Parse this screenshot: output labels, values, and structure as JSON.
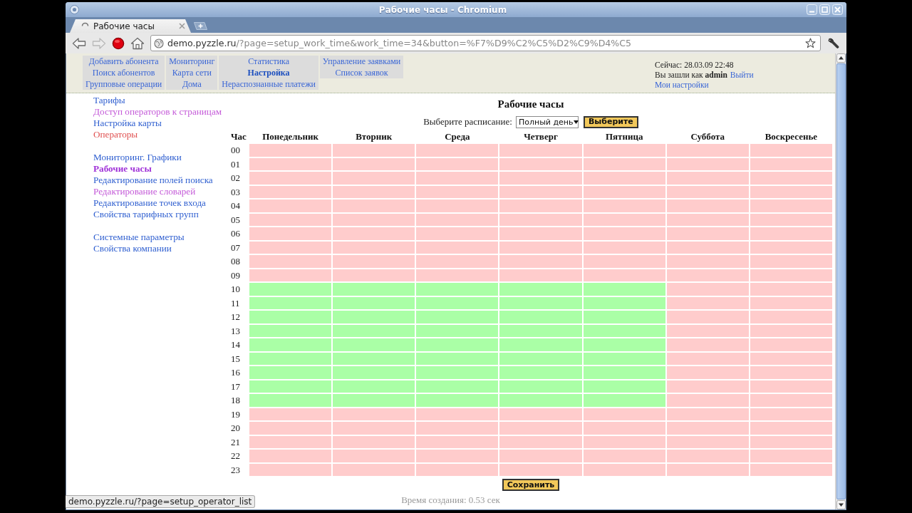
{
  "window": {
    "title": "Рабочие часы - Chromium"
  },
  "tabs": [
    {
      "label": "Рабочие часы",
      "selected": true,
      "loading": true
    }
  ],
  "toolbar": {
    "buttons": [
      {
        "kind": "back",
        "disabled": false
      },
      {
        "kind": "forward",
        "disabled": true
      },
      {
        "kind": "stop",
        "disabled": false
      },
      {
        "kind": "home",
        "disabled": false
      }
    ],
    "url_host": "demo.pyzzle.ru",
    "url_path": "/?page=setup_work_time&work_time=34&button=%F7%D9%C2%C5%D2%C9%D4%C5"
  },
  "nav_menu": [
    {
      "items": [
        {
          "label": "Добавить абонента",
          "selected": false
        },
        {
          "label": "Поиск абонентов",
          "selected": false
        },
        {
          "label": "Групповые операции",
          "selected": false
        }
      ]
    },
    {
      "items": [
        {
          "label": "Мониторинг",
          "selected": false
        },
        {
          "label": "Карта сети",
          "selected": false
        },
        {
          "label": "Дома",
          "selected": false
        }
      ]
    },
    {
      "items": [
        {
          "label": "Статистика",
          "selected": false
        },
        {
          "label": "Настройка",
          "selected": true
        },
        {
          "label": "Нераспознанные платежи",
          "selected": false
        }
      ]
    },
    {
      "items": [
        {
          "label": "Управление заявками",
          "selected": false
        },
        {
          "label": "Список заявок",
          "selected": false
        }
      ]
    }
  ],
  "user_panel": {
    "now": "Сейчас: 28.03.09 22:48",
    "login": "Вы зашли как **admin**",
    "logout": "Выйти",
    "settings": "Мои настройки"
  },
  "sidebar": {
    "groups": [
      {
        "items": [
          {
            "label": "Тарифы",
            "selected": false,
            "visited": false,
            "hovered": false
          },
          {
            "label": "Доступ операторов к страницам",
            "selected": false,
            "visited": true,
            "hovered": false
          },
          {
            "label": "Настройка карты",
            "selected": false,
            "visited": false,
            "hovered": false
          },
          {
            "label": "Операторы",
            "selected": false,
            "visited": false,
            "hovered": true
          }
        ]
      },
      {
        "items": [
          {
            "label": "Мониторинг. Графики",
            "selected": false,
            "visited": false,
            "hovered": false
          },
          {
            "label": "Рабочие часы",
            "selected": true,
            "visited": true,
            "hovered": false
          },
          {
            "label": "Редактирование полей поиска",
            "selected": false,
            "visited": false,
            "hovered": false
          },
          {
            "label": "Редактирование словарей",
            "selected": false,
            "visited": true,
            "hovered": false
          },
          {
            "label": "Редактирование точек входа",
            "selected": false,
            "visited": false,
            "hovered": false
          },
          {
            "label": "Свойства тарифных групп",
            "selected": false,
            "visited": false,
            "hovered": false
          }
        ]
      },
      {
        "items": [
          {
            "label": "Системные параметры",
            "selected": false,
            "visited": false,
            "hovered": false
          },
          {
            "label": "Свойства компании",
            "selected": false,
            "visited": false,
            "hovered": false
          }
        ]
      }
    ]
  },
  "page": {
    "heading": "Рабочие часы",
    "schedule_label": "Выберите расписание:",
    "schedule_value": "Полный день",
    "choose_button": "Выберите"
  },
  "table": {
    "columns": [
      "Час",
      "Понедельник",
      "Вторник",
      "Среда",
      "Четверг",
      "Пятница",
      "Суббота",
      "Воскресенье"
    ],
    "rows": [
      {
        "hour": "00",
        "on": [
          false,
          false,
          false,
          false,
          false,
          false,
          false
        ]
      },
      {
        "hour": "01",
        "on": [
          false,
          false,
          false,
          false,
          false,
          false,
          false
        ]
      },
      {
        "hour": "02",
        "on": [
          false,
          false,
          false,
          false,
          false,
          false,
          false
        ]
      },
      {
        "hour": "03",
        "on": [
          false,
          false,
          false,
          false,
          false,
          false,
          false
        ]
      },
      {
        "hour": "04",
        "on": [
          false,
          false,
          false,
          false,
          false,
          false,
          false
        ]
      },
      {
        "hour": "05",
        "on": [
          false,
          false,
          false,
          false,
          false,
          false,
          false
        ]
      },
      {
        "hour": "06",
        "on": [
          false,
          false,
          false,
          false,
          false,
          false,
          false
        ]
      },
      {
        "hour": "07",
        "on": [
          false,
          false,
          false,
          false,
          false,
          false,
          false
        ]
      },
      {
        "hour": "08",
        "on": [
          false,
          false,
          false,
          false,
          false,
          false,
          false
        ]
      },
      {
        "hour": "09",
        "on": [
          false,
          false,
          false,
          false,
          false,
          false,
          false
        ]
      },
      {
        "hour": "10",
        "on": [
          true,
          true,
          true,
          true,
          true,
          false,
          false
        ]
      },
      {
        "hour": "11",
        "on": [
          true,
          true,
          true,
          true,
          true,
          false,
          false
        ]
      },
      {
        "hour": "12",
        "on": [
          true,
          true,
          true,
          true,
          true,
          false,
          false
        ]
      },
      {
        "hour": "13",
        "on": [
          true,
          true,
          true,
          true,
          true,
          false,
          false
        ]
      },
      {
        "hour": "14",
        "on": [
          true,
          true,
          true,
          true,
          true,
          false,
          false
        ]
      },
      {
        "hour": "15",
        "on": [
          true,
          true,
          true,
          true,
          true,
          false,
          false
        ]
      },
      {
        "hour": "16",
        "on": [
          true,
          true,
          true,
          true,
          true,
          false,
          false
        ]
      },
      {
        "hour": "17",
        "on": [
          true,
          true,
          true,
          true,
          true,
          false,
          false
        ]
      },
      {
        "hour": "18",
        "on": [
          true,
          true,
          true,
          true,
          true,
          false,
          false
        ]
      },
      {
        "hour": "19",
        "on": [
          false,
          false,
          false,
          false,
          false,
          false,
          false
        ]
      },
      {
        "hour": "20",
        "on": [
          false,
          false,
          false,
          false,
          false,
          false,
          false
        ]
      },
      {
        "hour": "21",
        "on": [
          false,
          false,
          false,
          false,
          false,
          false,
          false
        ]
      },
      {
        "hour": "22",
        "on": [
          false,
          false,
          false,
          false,
          false,
          false,
          false
        ]
      },
      {
        "hour": "23",
        "on": [
          false,
          false,
          false,
          false,
          false,
          false,
          false
        ]
      }
    ]
  },
  "save_button": "Сохранить",
  "footer": "Время создания: 0.53 сек",
  "status_bar": {
    "text": "demo.pyzzle.ru/?page=setup_operator_list"
  }
}
